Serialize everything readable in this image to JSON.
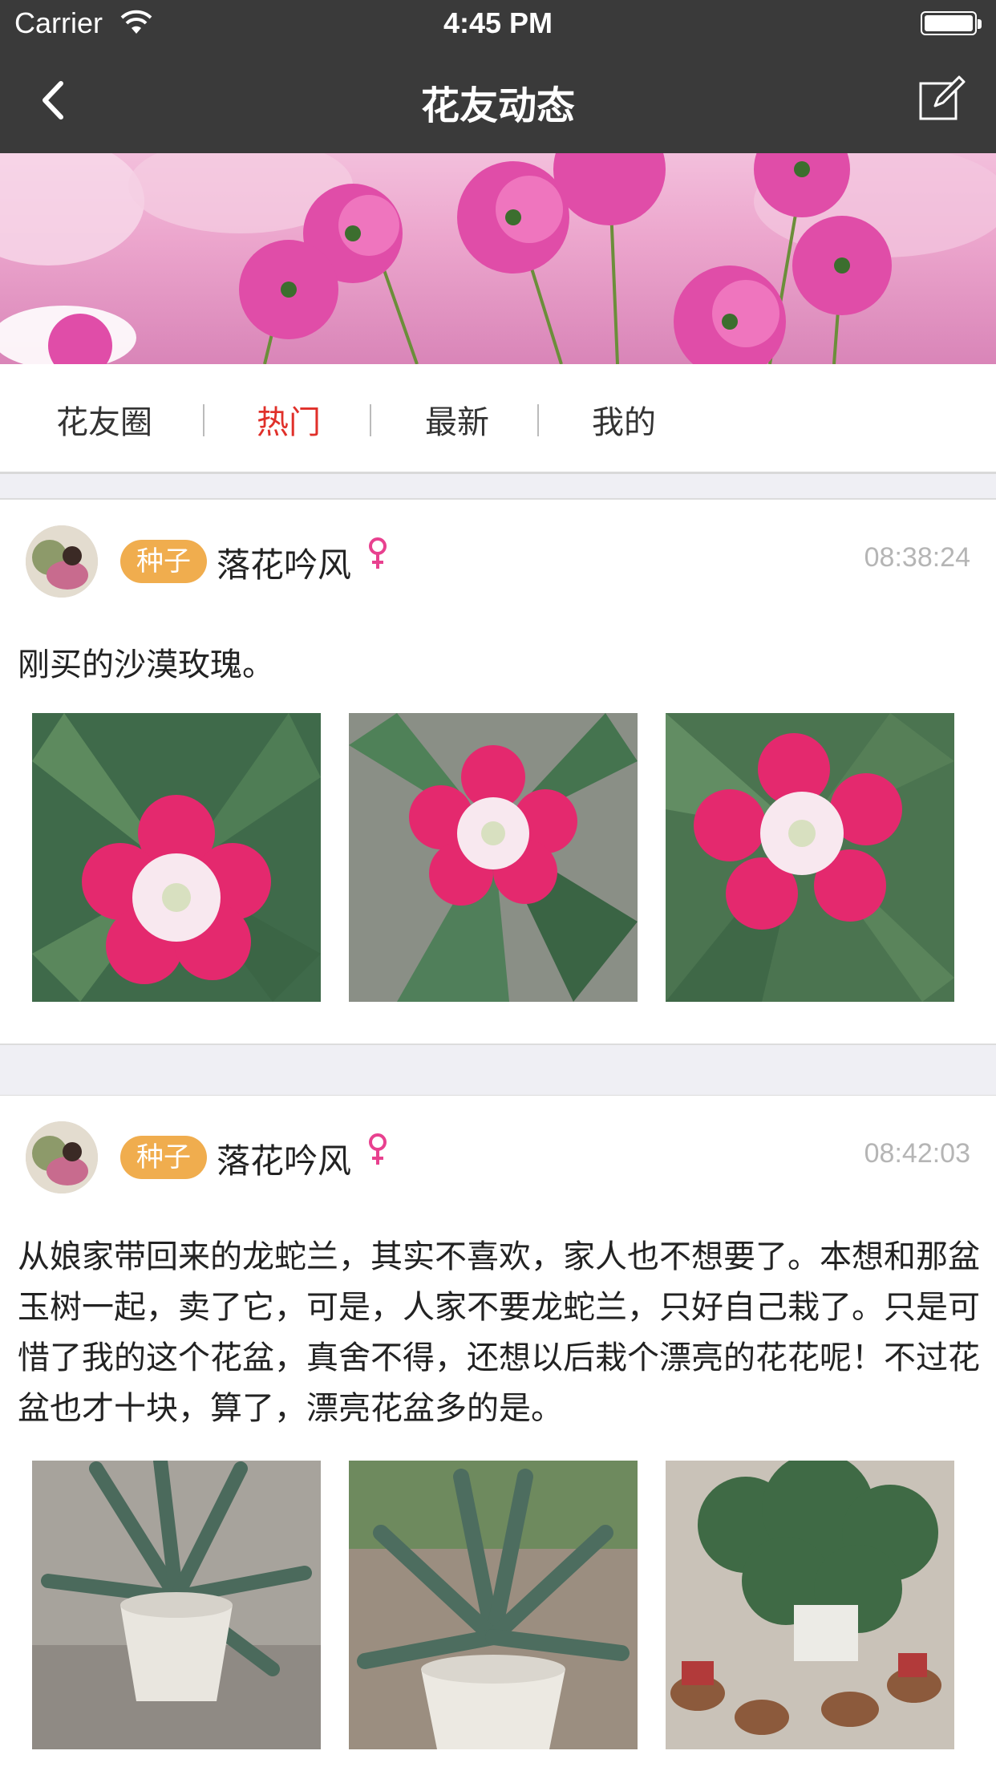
{
  "status_bar": {
    "carrier": "Carrier",
    "time": "4:45 PM"
  },
  "nav": {
    "title": "花友动态",
    "back_icon": "chevron-left-icon",
    "compose_icon": "compose-icon"
  },
  "tabs": [
    {
      "label": "花友圈",
      "active": false
    },
    {
      "label": "热门",
      "active": true
    },
    {
      "label": "最新",
      "active": false
    },
    {
      "label": "我的",
      "active": false
    }
  ],
  "colors": {
    "nav_bg": "#3a3a3a",
    "active_tab": "#e0302a",
    "badge": "#f0ad4e",
    "gender": "#e8418f",
    "time": "#b5b5b5"
  },
  "posts": [
    {
      "badge": "种子",
      "username": "落花吟风",
      "gender_icon": "female-icon",
      "time": "08:38:24",
      "content": "刚买的沙漠玫瑰。",
      "photos": [
        "desert-rose-photo",
        "desert-rose-photo",
        "desert-rose-photo"
      ]
    },
    {
      "badge": "种子",
      "username": "落花吟风",
      "gender_icon": "female-icon",
      "time": "08:42:03",
      "content": "从娘家带回来的龙蛇兰，其实不喜欢，家人也不想要了。本想和那盆玉树一起，卖了它，可是，人家不要龙蛇兰，只好自己栽了。只是可惜了我的这个花盆，真舍不得，还想以后栽个漂亮的花花呢！不过花盆也才十块，算了，漂亮花盆多的是。",
      "photos": [
        "agave-pot-photo",
        "agave-pot-photo",
        "jade-tree-photo"
      ]
    }
  ]
}
